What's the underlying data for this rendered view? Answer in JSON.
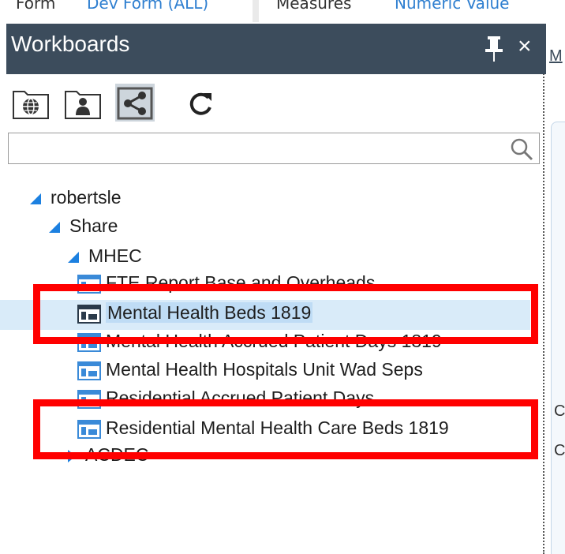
{
  "top_strip": {
    "left_label": "Form",
    "left_value": "Dev Form (ALL)",
    "measure_label": "Measures",
    "measure_value": "Numeric Value"
  },
  "panel": {
    "title": "Workboards",
    "pin_icon": "pin-icon",
    "close_glyph": "×"
  },
  "toolbar": {
    "buttons": [
      {
        "name": "globe",
        "icon": "globe-icon"
      },
      {
        "name": "user",
        "icon": "user-icon"
      },
      {
        "name": "share",
        "icon": "share-icon",
        "active": true
      }
    ],
    "refresh_icon": "refresh-icon"
  },
  "search": {
    "value": "",
    "placeholder": "",
    "icon": "search-icon"
  },
  "tree": {
    "root": "robertsle",
    "share": "Share",
    "mhec": "MHEC",
    "items": [
      "FTE Report Base and Overheads",
      "Mental Health Beds 1819",
      "Mental Health  Accrued Patient Days 1819",
      "Mental Health Hospitals Unit Wad Seps",
      "Residential Accrued Patient Days",
      "Residential Mental Health Care Beds 1819"
    ],
    "next_folder": "ACDEC"
  },
  "right_pane": {
    "tab_label": "M",
    "row1": "C",
    "row2": "C"
  },
  "colors": {
    "header_bg": "#3c4c5c",
    "selection_bg": "#d9ebf9",
    "highlight_red": "#ff0000",
    "tree_triangle": "#1c80e0"
  }
}
